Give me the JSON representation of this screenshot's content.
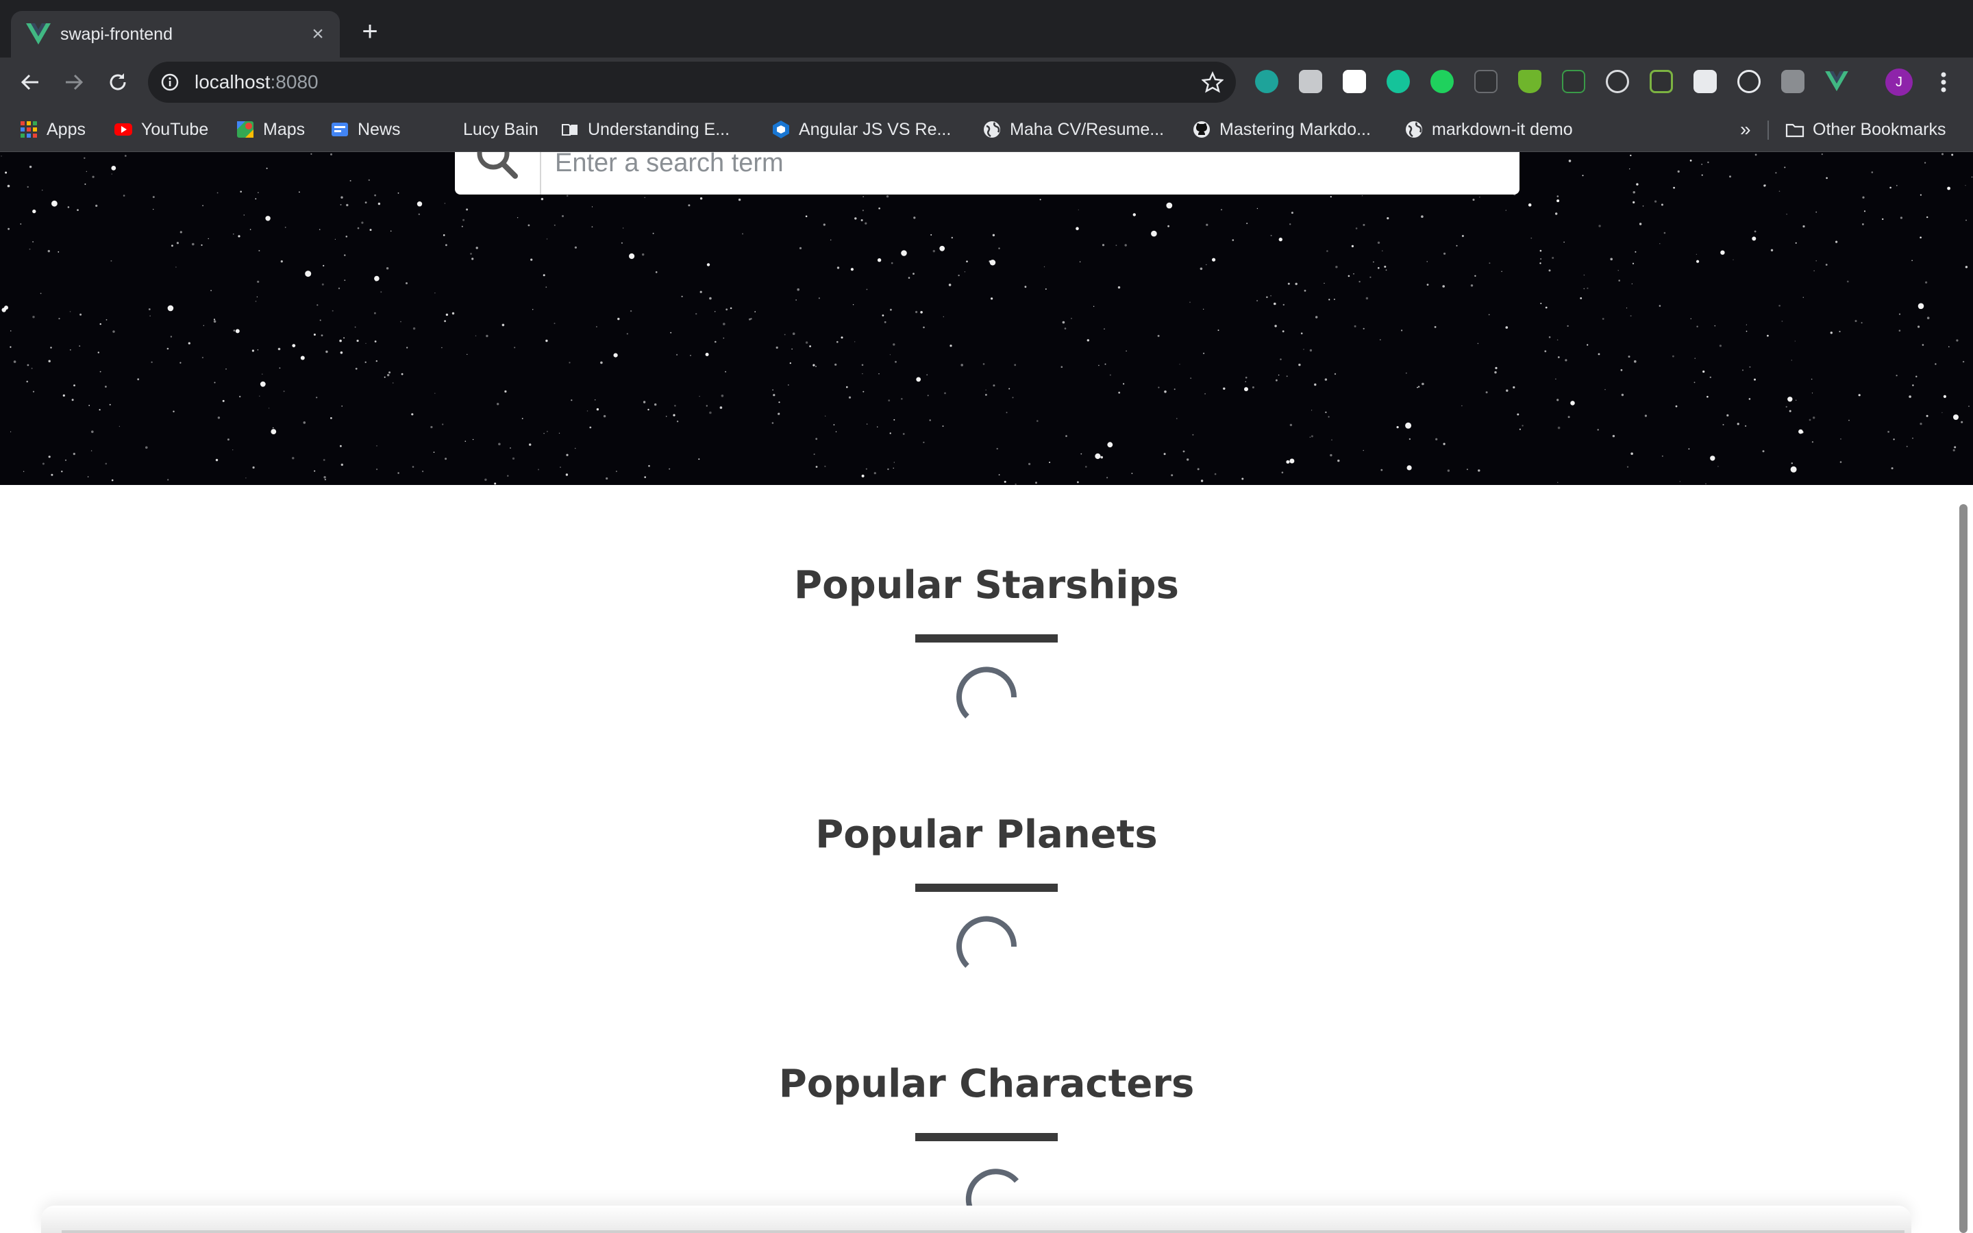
{
  "browser": {
    "tab_title": "swapi-frontend",
    "url_host": "localhost",
    "url_port": ":8080",
    "bookmarks": [
      {
        "label": "Apps",
        "icon": "apps-grid-icon"
      },
      {
        "label": "YouTube",
        "icon": "youtube-icon"
      },
      {
        "label": "Maps",
        "icon": "maps-icon"
      },
      {
        "label": "News",
        "icon": "news-icon"
      },
      {
        "label": "Lucy Bain",
        "icon": "blank-page-icon"
      },
      {
        "label": "Understanding E...",
        "icon": "book-icon"
      },
      {
        "label": "Angular JS VS Re...",
        "icon": "hexagon-icon"
      },
      {
        "label": "Maha CV/Resume...",
        "icon": "globe-icon"
      },
      {
        "label": "Mastering Markdo...",
        "icon": "github-icon"
      },
      {
        "label": "markdown-it demo",
        "icon": "globe-icon"
      }
    ],
    "more_bookmarks": "»",
    "other_bookmarks": "Other Bookmarks",
    "avatar_initial": "J"
  },
  "search": {
    "placeholder": "Enter a search term"
  },
  "sections": [
    {
      "title": "Popular Starships"
    },
    {
      "title": "Popular Planets"
    },
    {
      "title": "Popular Characters"
    }
  ],
  "colors": {
    "vue_green": "#41b883",
    "heading": "#3a3a3a",
    "spinner": "#5f6773"
  }
}
